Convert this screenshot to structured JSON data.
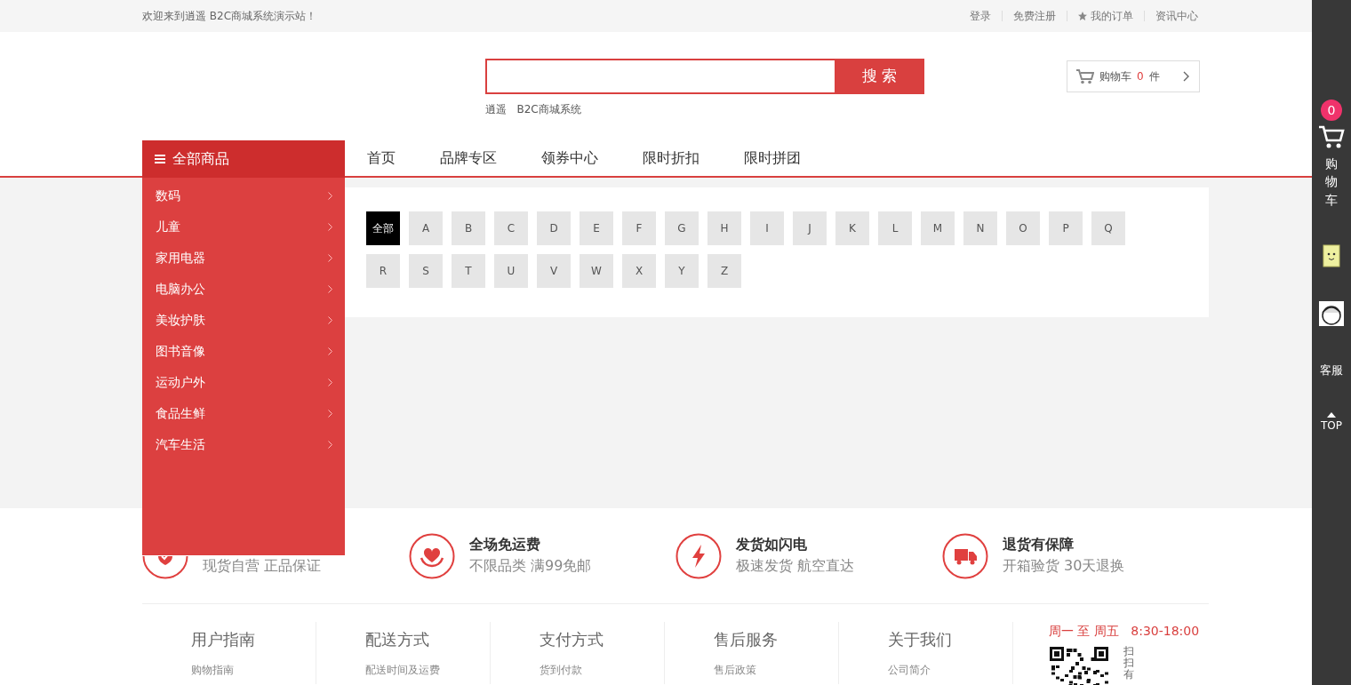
{
  "topbar": {
    "welcome": "欢迎来到逍遥 B2C商城系统演示站！",
    "links": [
      {
        "label": "登录",
        "icon": false
      },
      {
        "label": "免费注册",
        "icon": false
      },
      {
        "label": "我的订单",
        "icon": true
      },
      {
        "label": "资讯中心",
        "icon": false
      }
    ]
  },
  "search": {
    "button": "搜 索",
    "hint": "逍遥   B2C商城系统"
  },
  "cart": {
    "label": "购物车",
    "count": "0",
    "unit": "件"
  },
  "category_menu": {
    "title": "全部商品",
    "items": [
      "数码",
      "儿童",
      "家用电器",
      "电脑办公",
      "美妆护肤",
      "图书音像",
      "运动户外",
      "食品生鲜",
      "汽车生活"
    ]
  },
  "nav": [
    "首页",
    "品牌专区",
    "领券中心",
    "限时折扣",
    "限时拼团"
  ],
  "letters": [
    {
      "label": "全部",
      "selected": true
    },
    {
      "label": "A",
      "selected": false
    },
    {
      "label": "B",
      "selected": false
    },
    {
      "label": "C",
      "selected": false
    },
    {
      "label": "D",
      "selected": false
    },
    {
      "label": "E",
      "selected": false
    },
    {
      "label": "F",
      "selected": false
    },
    {
      "label": "G",
      "selected": false
    },
    {
      "label": "H",
      "selected": false
    },
    {
      "label": "I",
      "selected": false
    },
    {
      "label": "J",
      "selected": false
    },
    {
      "label": "K",
      "selected": false
    },
    {
      "label": "L",
      "selected": false
    },
    {
      "label": "M",
      "selected": false
    },
    {
      "label": "N",
      "selected": false
    },
    {
      "label": "O",
      "selected": false
    },
    {
      "label": "P",
      "selected": false
    },
    {
      "label": "Q",
      "selected": false
    },
    {
      "label": "R",
      "selected": false
    },
    {
      "label": "S",
      "selected": false
    },
    {
      "label": "T",
      "selected": false
    },
    {
      "label": "U",
      "selected": false
    },
    {
      "label": "V",
      "selected": false
    },
    {
      "label": "W",
      "selected": false
    },
    {
      "label": "X",
      "selected": false
    },
    {
      "label": "Y",
      "selected": false
    },
    {
      "label": "Z",
      "selected": false
    }
  ],
  "features": [
    {
      "kind": "shield",
      "subtitle": "现货自营 正品保证"
    },
    {
      "kind": "heart",
      "title": "全场免运费",
      "subtitle": "不限品类 满99免邮"
    },
    {
      "kind": "bolt",
      "title": "发货如闪电",
      "subtitle": "极速发货 航空直达"
    },
    {
      "kind": "truck",
      "title": "退货有保障",
      "subtitle": "开箱验货 30天退换"
    }
  ],
  "footer": {
    "columns": [
      {
        "title": "用户指南",
        "link": "购物指南"
      },
      {
        "title": "配送方式",
        "link": "配送时间及运费"
      },
      {
        "title": "支付方式",
        "link": "货到付款"
      },
      {
        "title": "售后服务",
        "link": "售后政策"
      },
      {
        "title": "关于我们",
        "link": "公司简介"
      }
    ],
    "hours": "周一 至 周五   8:30-18:00",
    "qr_caption": "扫扫有"
  },
  "side_toolbar": {
    "cart_badge": "0",
    "cart_label": "购物车",
    "service_label": "客服",
    "top_label": "TOP"
  }
}
